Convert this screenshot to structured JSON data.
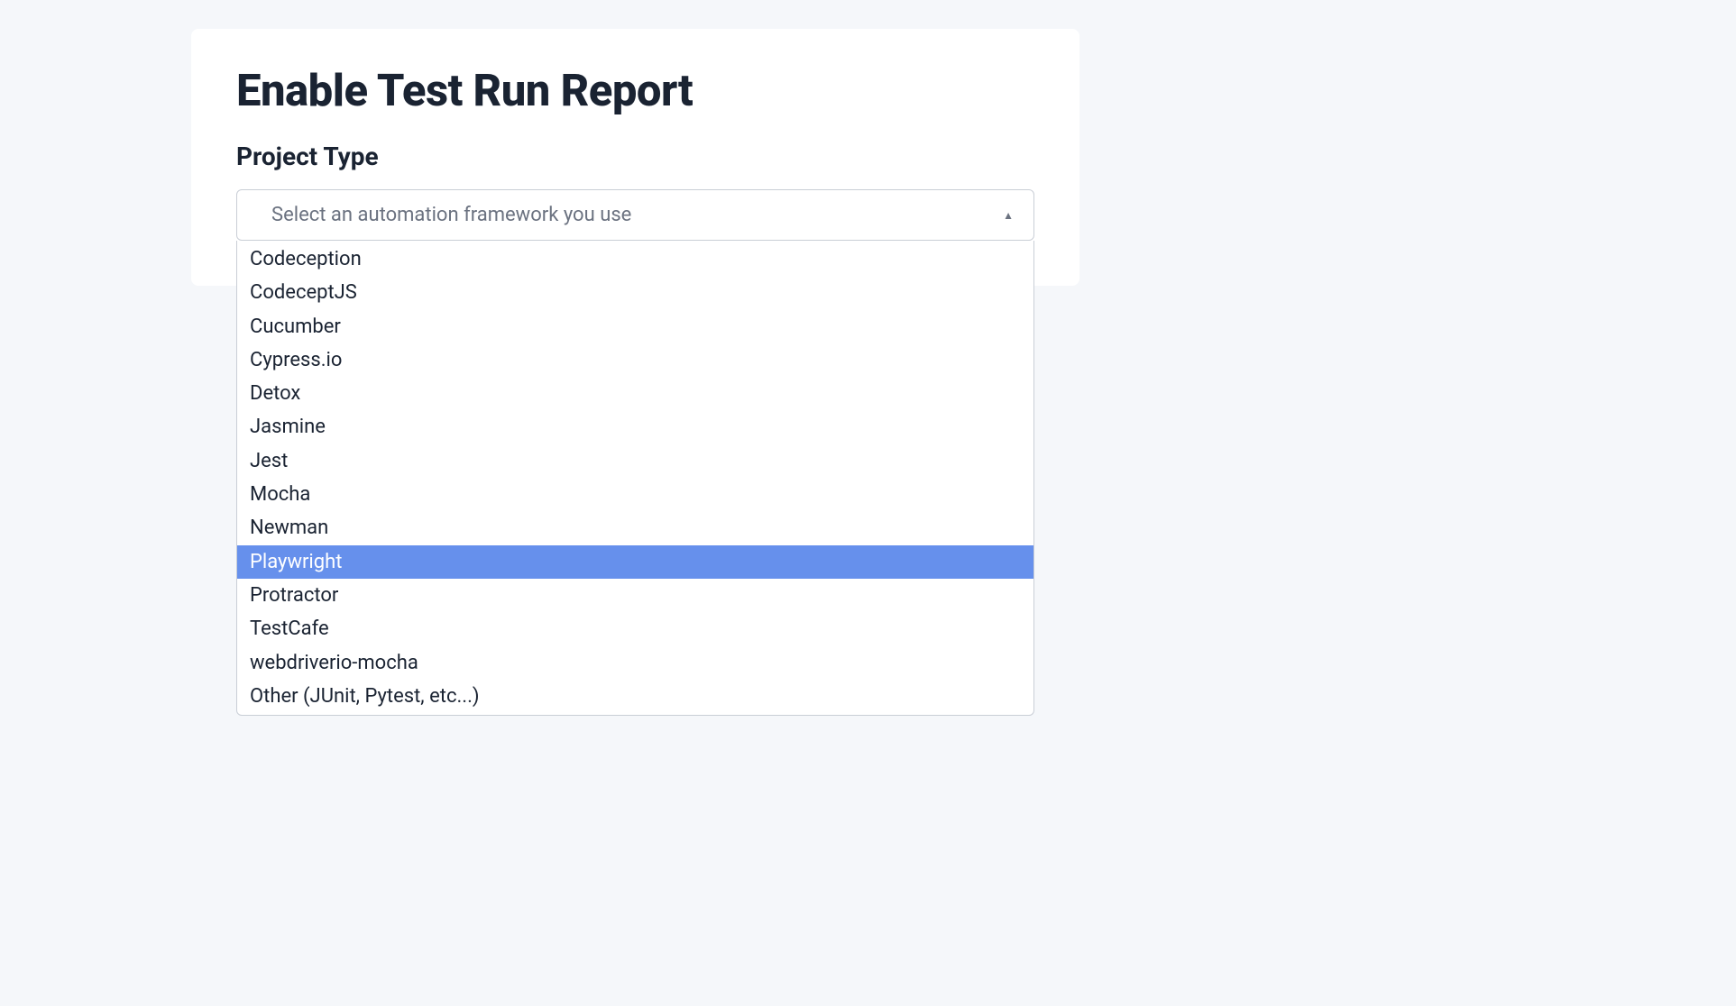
{
  "card": {
    "title": "Enable Test Run Report",
    "section_label": "Project Type",
    "select": {
      "placeholder": "Select an automation framework you use",
      "options": [
        {
          "label": "Codeception",
          "highlighted": false
        },
        {
          "label": "CodeceptJS",
          "highlighted": false
        },
        {
          "label": "Cucumber",
          "highlighted": false
        },
        {
          "label": "Cypress.io",
          "highlighted": false
        },
        {
          "label": "Detox",
          "highlighted": false
        },
        {
          "label": "Jasmine",
          "highlighted": false
        },
        {
          "label": "Jest",
          "highlighted": false
        },
        {
          "label": "Mocha",
          "highlighted": false
        },
        {
          "label": "Newman",
          "highlighted": false
        },
        {
          "label": "Playwright",
          "highlighted": true
        },
        {
          "label": "Protractor",
          "highlighted": false
        },
        {
          "label": "TestCafe",
          "highlighted": false
        },
        {
          "label": "webdriverio-mocha",
          "highlighted": false
        },
        {
          "label": "Other (JUnit, Pytest, etc...)",
          "highlighted": false
        }
      ]
    }
  }
}
